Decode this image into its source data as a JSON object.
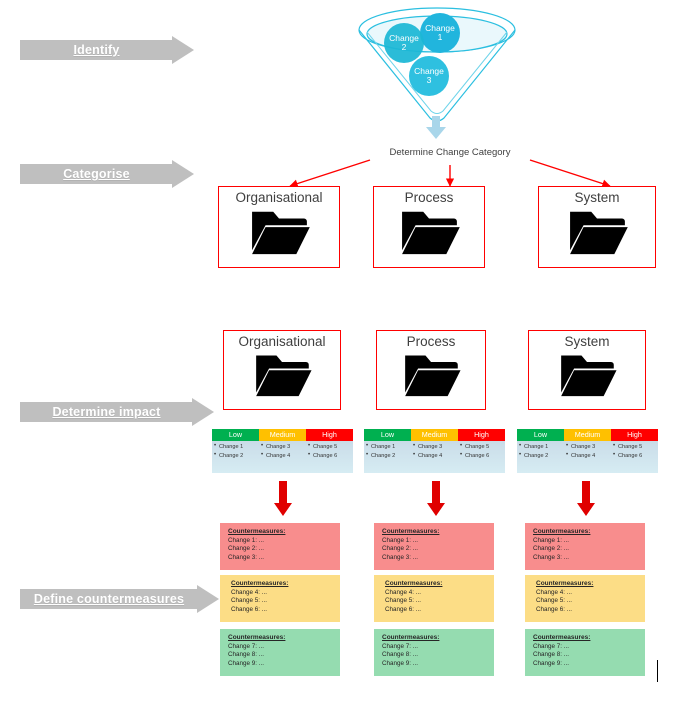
{
  "stages": [
    {
      "label": "Identify",
      "name": "stage-identify"
    },
    {
      "label": "Categorise",
      "name": "stage-categorise"
    },
    {
      "label": "Determine impact",
      "name": "stage-determine-impact"
    },
    {
      "label": "Define countermeasures",
      "name": "stage-define-countermeasures"
    }
  ],
  "funnel": {
    "icon": "funnel-icon",
    "down_arrow": "down-arrow-icon",
    "bubbles": [
      {
        "line1": "Change",
        "line2": "1"
      },
      {
        "line1": "Change",
        "line2": "2"
      },
      {
        "line1": "Change",
        "line2": "3"
      }
    ]
  },
  "decision": {
    "label": "Determine Change Category"
  },
  "categories": [
    {
      "title": "Organisational",
      "icon": "folder-icon"
    },
    {
      "title": "Process",
      "icon": "folder-icon"
    },
    {
      "title": "System",
      "icon": "folder-icon"
    }
  ],
  "impact_levels": [
    {
      "header": "Low",
      "items": [
        "Change 1",
        "Change 2"
      ],
      "color": "#00b050"
    },
    {
      "header": "Medium",
      "items": [
        "Change 3",
        "Change 4"
      ],
      "color": "#ffc000"
    },
    {
      "header": "High",
      "items": [
        "Change 5",
        "Change 6"
      ],
      "color": "#ff0000"
    }
  ],
  "countermeasures": [
    {
      "title": "Countermeasures:",
      "lines": [
        "Change 1: ...",
        "Change 2: ...",
        "Change 3: ..."
      ],
      "color": "#f88d8d"
    },
    {
      "title": "Countermeasures:",
      "lines": [
        "Change 4: ...",
        "Change 5: ...",
        "Change 6: ..."
      ],
      "color": "#fcdd86"
    },
    {
      "title": "Countermeasures:",
      "lines": [
        "Change 7: ...",
        "Change 8: ...",
        "Change 9: ..."
      ],
      "color": "#95dcb0"
    }
  ],
  "colors": {
    "stage_arrow": "#bfbfbf",
    "connector": "#ff0000",
    "box_border": "#ff0000",
    "funnel_line": "#2bbfe0",
    "bubble": "#21b5dd"
  }
}
